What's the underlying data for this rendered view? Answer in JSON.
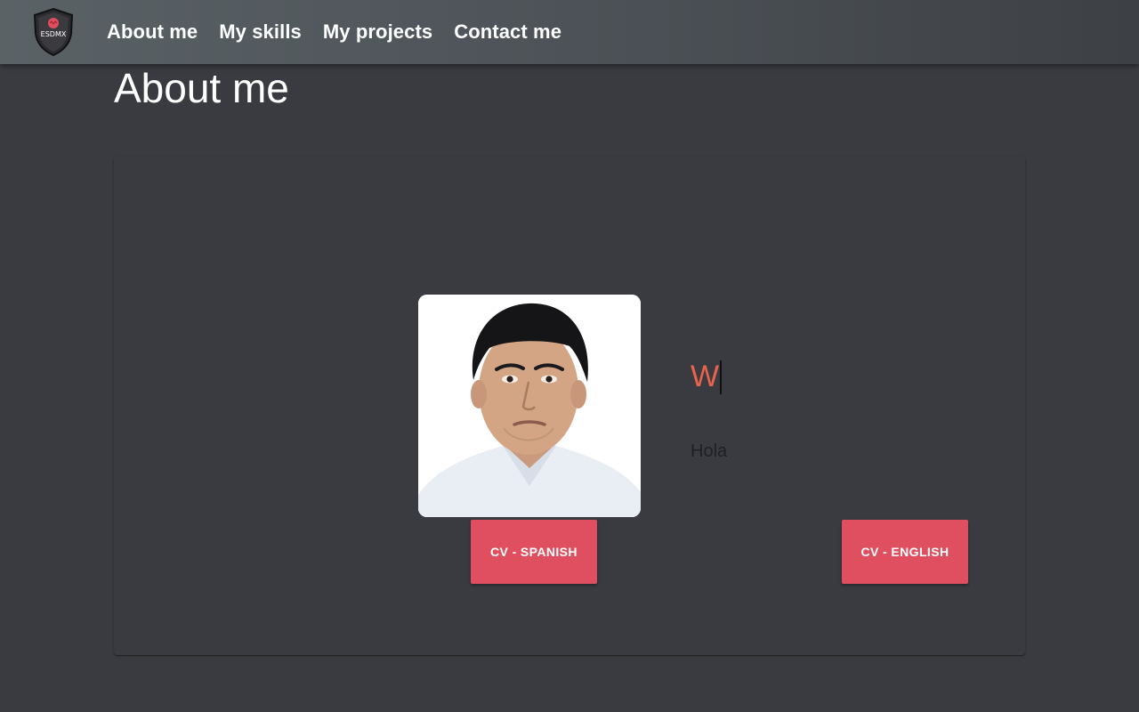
{
  "navbar": {
    "logo_text": "ESDMX",
    "links": [
      {
        "label": "About me"
      },
      {
        "label": "My skills"
      },
      {
        "label": "My projects"
      },
      {
        "label": "Contact me"
      }
    ]
  },
  "page": {
    "title": "About me"
  },
  "about": {
    "typed_text": "W",
    "greeting": "Hola",
    "buttons": {
      "cv_spanish": "CV - SPANISH",
      "cv_english": "CV - ENGLISH"
    }
  },
  "colors": {
    "background": "#393b40",
    "accent_button": "#e04f5f",
    "typed_text": "#e8644c"
  }
}
